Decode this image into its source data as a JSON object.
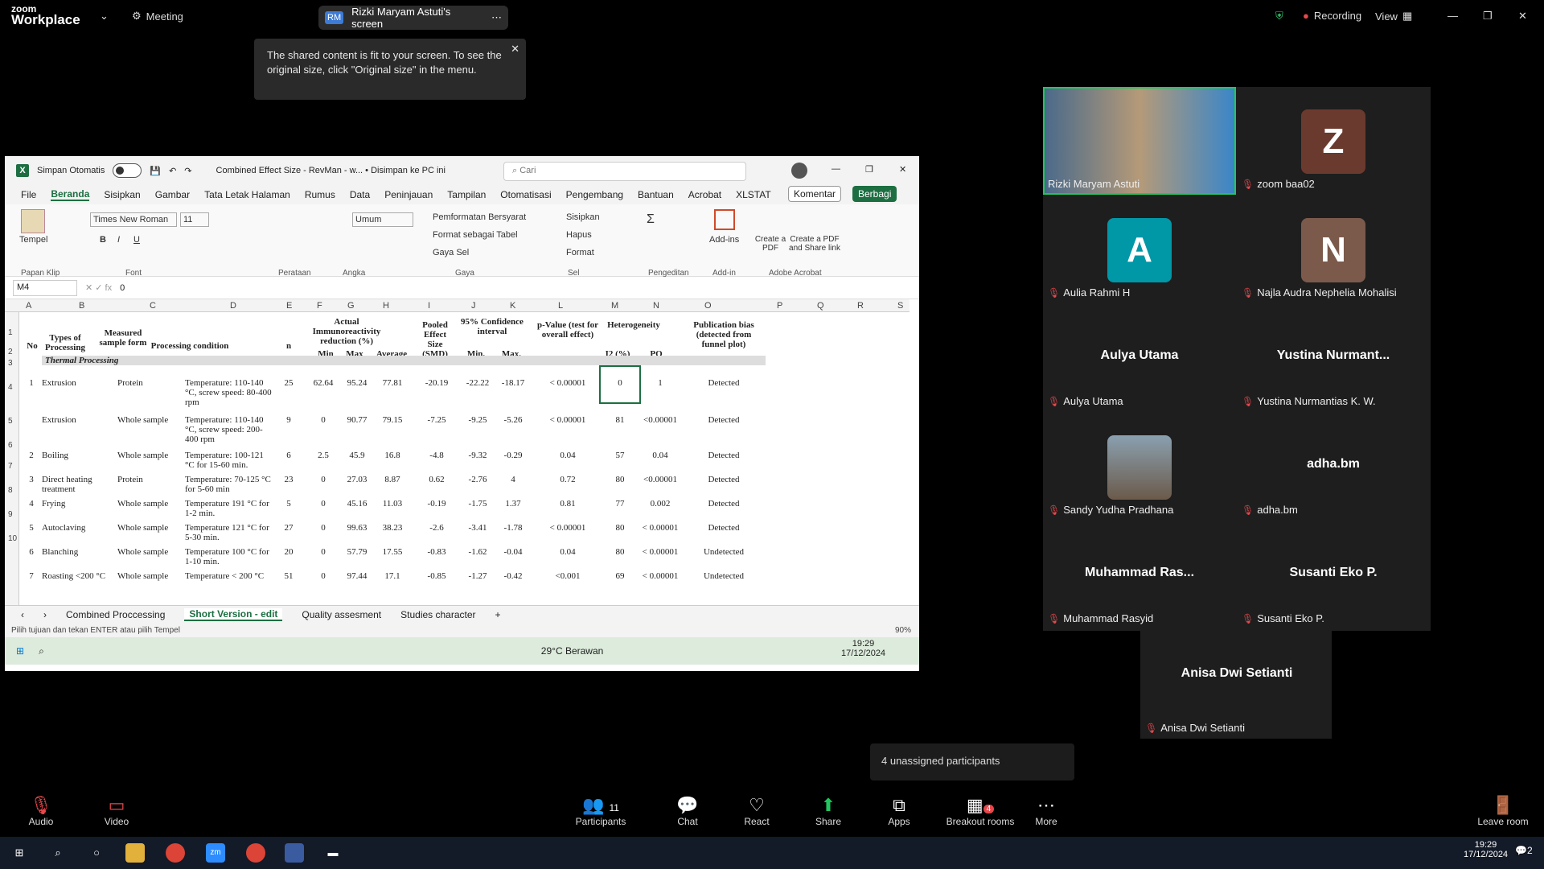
{
  "zoom": {
    "brand_small": "zoom",
    "brand": "Workplace",
    "meeting": "Meeting",
    "share_initials": "RM",
    "share_label": "Rizki Maryam Astuti's screen",
    "recording": "Recording",
    "view": "View",
    "tooltip": "The shared content is fit to your screen. To see the original size, click \"Original size\" in the menu."
  },
  "excel": {
    "autosave": "Simpan Otomatis",
    "title": "Combined Effect Size - RevMan - w... • Disimpan ke PC ini",
    "search": "Cari",
    "menus": [
      "File",
      "Beranda",
      "Sisipkan",
      "Gambar",
      "Tata Letak Halaman",
      "Rumus",
      "Data",
      "Peninjauan",
      "Tampilan",
      "Otomatisasi",
      "Pengembang",
      "Bantuan",
      "Acrobat",
      "XLSTAT"
    ],
    "komentar": "Komentar",
    "berbagi": "Berbagi",
    "ribbon": {
      "tempel": "Tempel",
      "font": "Times New Roman",
      "size": "11",
      "format": "Umum",
      "cond": "Pemformatan Bersyarat",
      "table": "Format sebagai Tabel",
      "style": "Gaya Sel",
      "insert": "Sisipkan",
      "delete": "Hapus",
      "fmt": "Format",
      "addins": "Add-ins",
      "createpdf": "Create a PDF",
      "createshare": "Create a PDF and Share link",
      "groups": [
        "Papan Klip",
        "Font",
        "Perataan",
        "Angka",
        "Gaya",
        "Sel",
        "Pengeditan",
        "Add-in",
        "Adobe Acrobat"
      ]
    },
    "namebox": "M4",
    "formula": "0",
    "columns": [
      "A",
      "B",
      "C",
      "D",
      "E",
      "F",
      "G",
      "H",
      "I",
      "J",
      "K",
      "L",
      "M",
      "N",
      "O",
      "P",
      "Q",
      "R",
      "S"
    ],
    "rows": [
      "1",
      "2",
      "3",
      "4",
      "5",
      "6",
      "7",
      "8",
      "9",
      "10"
    ],
    "headers": {
      "no": "No",
      "types": "Types of Processing",
      "measured": "Measured sample form",
      "proc": "Processing condition",
      "n": "n",
      "actual": "Actual Immunoreactivity reduction (%)",
      "min": "Min",
      "max": "Max",
      "avg": "Average",
      "pooled": "Pooled Effect Size (SMD)",
      "ci": "95% Confidence interval",
      "cimin": "Min.",
      "cimax": "Max.",
      "pval": "p-Value (test for overall effect)",
      "het": "Heterogeneity",
      "i2": "I2 (%)",
      "pq": "PQ",
      "pub": "Publication bias (detected from funnel plot)"
    },
    "section": "Thermal Processing",
    "data": [
      {
        "no": "1",
        "type": "Extrusion",
        "form": "Protein",
        "cond": "Temperature: 110-140 °C, screw speed: 80-400 rpm",
        "n": "25",
        "min": "62.64",
        "max": "95.24",
        "avg": "77.81",
        "smd": "-20.19",
        "lo": "-22.22",
        "hi": "-18.17",
        "p": "< 0.00001",
        "i2": "0",
        "pq": "1",
        "pub": "Detected"
      },
      {
        "no": "",
        "type": "Extrusion",
        "form": "Whole sample",
        "cond": "Temperature: 110-140 °C, screw speed: 200-400 rpm",
        "n": "9",
        "min": "0",
        "max": "90.77",
        "avg": "79.15",
        "smd": "-7.25",
        "lo": "-9.25",
        "hi": "-5.26",
        "p": "< 0.00001",
        "i2": "81",
        "pq": "<0.00001",
        "pub": "Detected"
      },
      {
        "no": "2",
        "type": "Boiling",
        "form": "Whole sample",
        "cond": "Temperature: 100-121 °C for 15-60 min.",
        "n": "6",
        "min": "2.5",
        "max": "45.9",
        "avg": "16.8",
        "smd": "-4.8",
        "lo": "-9.32",
        "hi": "-0.29",
        "p": "0.04",
        "i2": "57",
        "pq": "0.04",
        "pub": "Detected"
      },
      {
        "no": "3",
        "type": "Direct heating treatment",
        "form": "Protein",
        "cond": "Temperature: 70-125 °C for 5-60 min",
        "n": "23",
        "min": "0",
        "max": "27.03",
        "avg": "8.87",
        "smd": "0.62",
        "lo": "-2.76",
        "hi": "4",
        "p": "0.72",
        "i2": "80",
        "pq": "<0.00001",
        "pub": "Detected"
      },
      {
        "no": "4",
        "type": "Frying",
        "form": "Whole sample",
        "cond": "Temperature 191 °C for 1-2 min.",
        "n": "5",
        "min": "0",
        "max": "45.16",
        "avg": "11.03",
        "smd": "-0.19",
        "lo": "-1.75",
        "hi": "1.37",
        "p": "0.81",
        "i2": "77",
        "pq": "0.002",
        "pub": "Detected"
      },
      {
        "no": "5",
        "type": "Autoclaving",
        "form": "Whole sample",
        "cond": "Temperature 121 °C for 5-30 min.",
        "n": "27",
        "min": "0",
        "max": "99.63",
        "avg": "38.23",
        "smd": "-2.6",
        "lo": "-3.41",
        "hi": "-1.78",
        "p": "< 0.00001",
        "i2": "80",
        "pq": "< 0.00001",
        "pub": "Detected"
      },
      {
        "no": "6",
        "type": "Blanching",
        "form": "Whole sample",
        "cond": "Temperature 100 °C for 1-10 min.",
        "n": "20",
        "min": "0",
        "max": "57.79",
        "avg": "17.55",
        "smd": "-0.83",
        "lo": "-1.62",
        "hi": "-0.04",
        "p": "0.04",
        "i2": "80",
        "pq": "< 0.00001",
        "pub": "Undetected"
      },
      {
        "no": "7",
        "type": "Roasting <200 °C",
        "form": "Whole sample",
        "cond": "Temperature < 200 °C",
        "n": "51",
        "min": "0",
        "max": "97.44",
        "avg": "17.1",
        "smd": "-0.85",
        "lo": "-1.27",
        "hi": "-0.42",
        "p": "<0.001",
        "i2": "69",
        "pq": "< 0.00001",
        "pub": "Undetected"
      }
    ],
    "tabs": [
      "Combined Proccessing",
      "Short Version - edit",
      "Quality assesment",
      "Studies character"
    ],
    "status": "Pilih tujuan dan tekan ENTER atau pilih Tempel",
    "zoom": "90%",
    "weather": "29°C Berawan",
    "time": "19:29",
    "date": "17/12/2024"
  },
  "participants": [
    {
      "name": "Rizki Maryam Astuti"
    },
    {
      "name": "zoom baa02",
      "initial": "Z"
    },
    {
      "name": "Aulia Rahmi H",
      "initial": "A"
    },
    {
      "name": "Najla Audra Nephelia Mohalisi",
      "initial": "N"
    },
    {
      "name": "Aulya Utama",
      "big": "Aulya Utama"
    },
    {
      "name": "Yustina Nurmantias K. W.",
      "big": "Yustina  Nurmant..."
    },
    {
      "name": "Sandy Yudha Pradhana"
    },
    {
      "name": "adha.bm",
      "big": "adha.bm"
    },
    {
      "name": "Muhammad Rasyid",
      "big": "Muhammad  Ras..."
    },
    {
      "name": "Susanti Eko P.",
      "big": "Susanti Eko P."
    },
    {
      "name": "Anisa Dwi Setianti",
      "big": "Anisa Dwi Setianti"
    }
  ],
  "unassigned": "4 unassigned participants",
  "controls": {
    "audio": "Audio",
    "video": "Video",
    "participants": "Participants",
    "count": "11",
    "chat": "Chat",
    "react": "React",
    "share": "Share",
    "apps": "Apps",
    "breakout": "Breakout rooms",
    "breakout_badge": "4",
    "more": "More",
    "leave": "Leave room"
  },
  "clock": {
    "time": "19:29",
    "date": "17/12/2024",
    "notif": "2"
  }
}
